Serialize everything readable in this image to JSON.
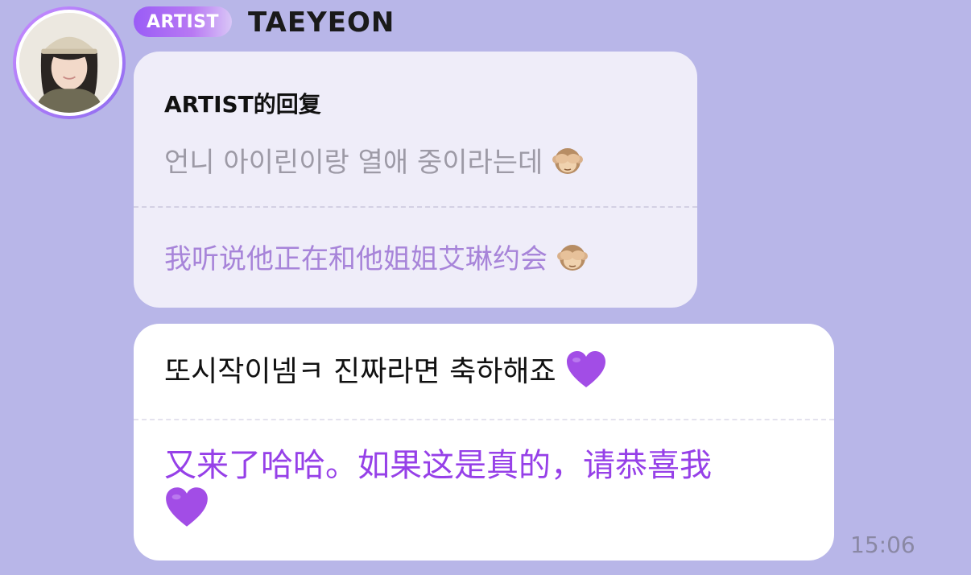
{
  "header": {
    "badge": "ARTIST",
    "name": "TAEYEON"
  },
  "avatar": {
    "icon": "profile-photo-icon"
  },
  "reply": {
    "title": "ARTIST的回复",
    "original": "언니 아이린이랑 열애 중이라는데",
    "translation": "我听说他正在和他姐姐艾琳约会",
    "emoji": "see-no-evil-monkey-icon"
  },
  "message": {
    "original": "또시작이넴ㅋ 진짜라면 축하해죠",
    "translation": "又来了哈哈。如果这是真的，请恭喜我",
    "emoji": "purple-heart-icon"
  },
  "time": "15:06",
  "colors": {
    "background": "#b8b6e8",
    "reply_bubble": "#efedf9",
    "message_bubble": "#ffffff",
    "reply_translation": "#a784d9",
    "message_translation": "#9640e8",
    "badge_start": "#9a5cf6"
  }
}
